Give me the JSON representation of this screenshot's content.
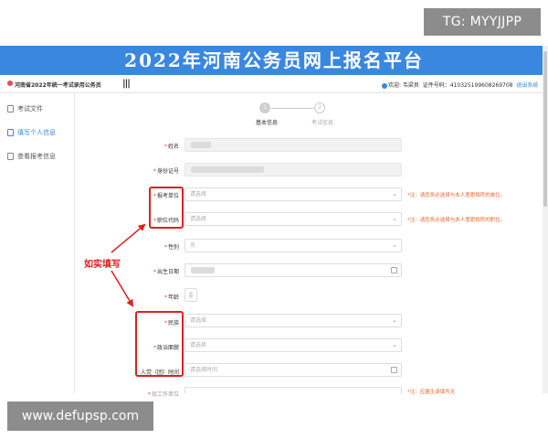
{
  "watermarks": {
    "top": "TG: MYYJJPP",
    "bottom": "www.defupsp.com"
  },
  "banner": {
    "title": "2022年河南公务员网上报名平台"
  },
  "topbar": {
    "org": "河南省2022年统一考试录用公务员",
    "menu_glyph": "|||",
    "user_greeting": "欢迎: 韦梁良",
    "id_label": "证件号码：",
    "id_value": "410325199608269708",
    "logout": "退出系统"
  },
  "sidebar": {
    "items": [
      {
        "label": "考试文件",
        "icon": "document-icon"
      },
      {
        "label": "填写个人信息",
        "icon": "user-edit-icon"
      },
      {
        "label": "查看报考信息",
        "icon": "id-card-icon"
      }
    ]
  },
  "steps": [
    {
      "num": "1",
      "label": "基本信息"
    },
    {
      "num": "2",
      "label": "考试信息"
    }
  ],
  "form": {
    "name_label": "姓名",
    "id_label": "身份证号",
    "unit_label": "报考单位",
    "unit_placeholder": "请选择",
    "unit_note": "*注：请您务必选择与本人意愿相符的单位。",
    "post_label": "职位代码",
    "post_placeholder": "请选择",
    "post_note": "*注：请您务必选择与本人意愿相符的职位。",
    "gender_label": "性别",
    "gender_value": "男",
    "birth_label": "出生日期",
    "age_label": "年龄",
    "ethnic_label": "民族",
    "ethnic_placeholder": "请选择",
    "political_label": "政治面貌",
    "political_placeholder": "请选择",
    "party_label": "入党（团）时间",
    "party_placeholder": "请选择时间",
    "cut_label": "现工作单位",
    "cut_note": "*注：应届生请填写无"
  },
  "annotation": {
    "callout": "如实填写"
  },
  "colors": {
    "banner": "#3a87e0",
    "highlight": "#e02020",
    "note": "#e8672a",
    "accent": "#3a87e0"
  }
}
